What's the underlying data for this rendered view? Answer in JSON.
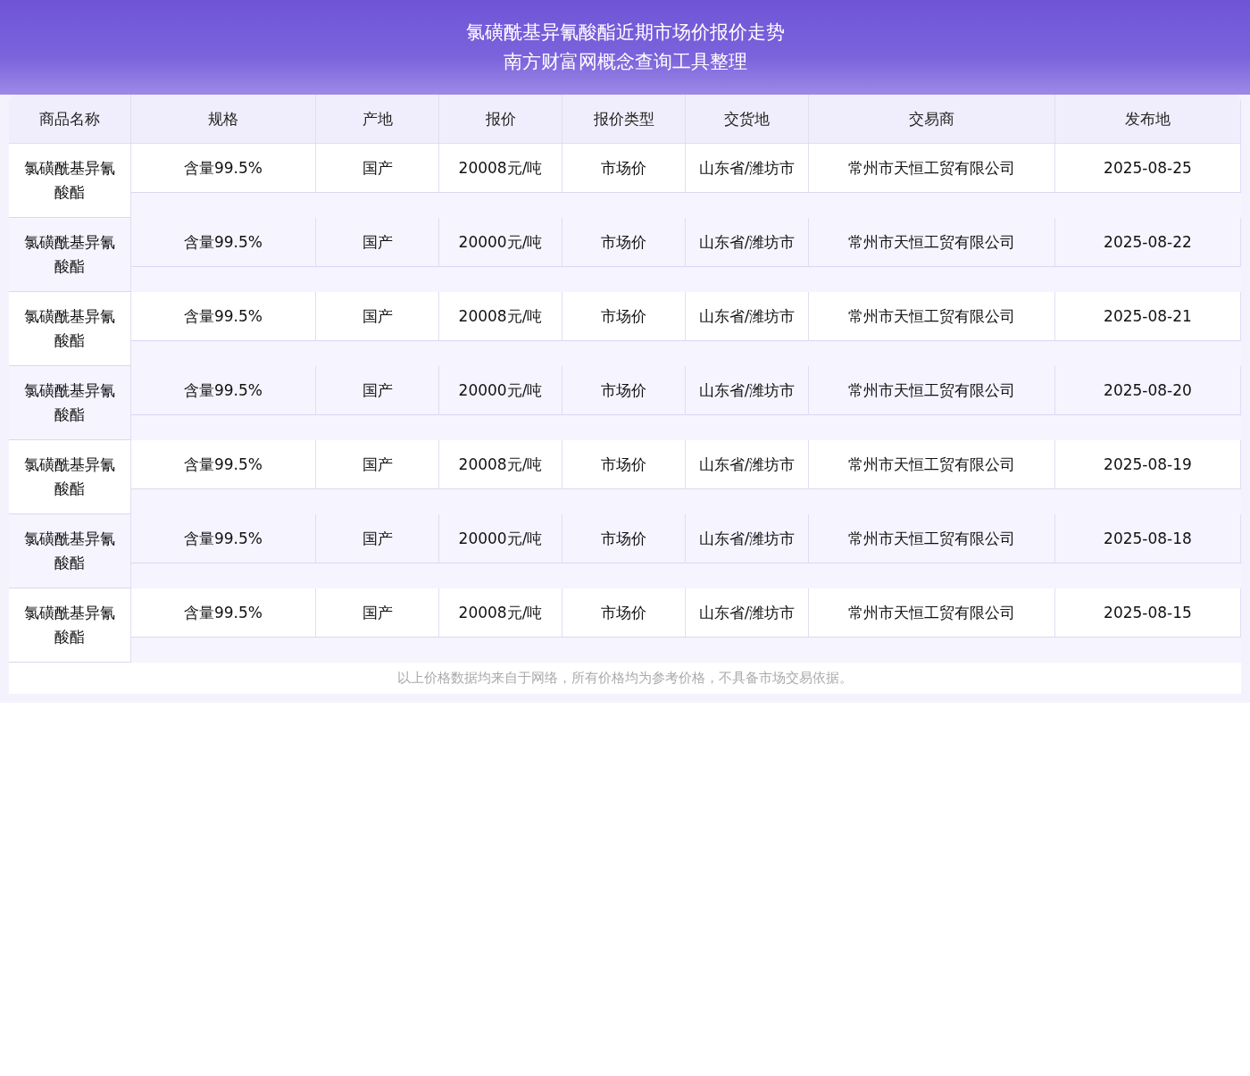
{
  "header": {
    "title": "氯磺酰基异氰酸酯近期市场价报价走势",
    "subtitle": "南方财富网概念查询工具整理"
  },
  "table": {
    "columns": [
      "商品名称",
      "规格",
      "产地",
      "报价",
      "报价类型",
      "交货地",
      "交易商",
      "发布地"
    ],
    "rows": [
      [
        "氯磺酰基异氰酸酯",
        "含量99.5%",
        "国产",
        "20008元/吨",
        "市场价",
        "山东省/潍坊市",
        "常州市天恒工贸有限公司",
        "2025-08-25"
      ],
      [
        "氯磺酰基异氰酸酯",
        "含量99.5%",
        "国产",
        "20000元/吨",
        "市场价",
        "山东省/潍坊市",
        "常州市天恒工贸有限公司",
        "2025-08-22"
      ],
      [
        "氯磺酰基异氰酸酯",
        "含量99.5%",
        "国产",
        "20008元/吨",
        "市场价",
        "山东省/潍坊市",
        "常州市天恒工贸有限公司",
        "2025-08-21"
      ],
      [
        "氯磺酰基异氰酸酯",
        "含量99.5%",
        "国产",
        "20000元/吨",
        "市场价",
        "山东省/潍坊市",
        "常州市天恒工贸有限公司",
        "2025-08-20"
      ],
      [
        "氯磺酰基异氰酸酯",
        "含量99.5%",
        "国产",
        "20008元/吨",
        "市场价",
        "山东省/潍坊市",
        "常州市天恒工贸有限公司",
        "2025-08-19"
      ],
      [
        "氯磺酰基异氰酸酯",
        "含量99.5%",
        "国产",
        "20000元/吨",
        "市场价",
        "山东省/潍坊市",
        "常州市天恒工贸有限公司",
        "2025-08-18"
      ],
      [
        "氯磺酰基异氰酸酯",
        "含量99.5%",
        "国产",
        "20008元/吨",
        "市场价",
        "山东省/潍坊市",
        "常州市天恒工贸有限公司",
        "2025-08-15"
      ]
    ]
  },
  "footer_note": "以上价格数据均来自于网络，所有价格均为参考价格，不具备市场交易依据。"
}
